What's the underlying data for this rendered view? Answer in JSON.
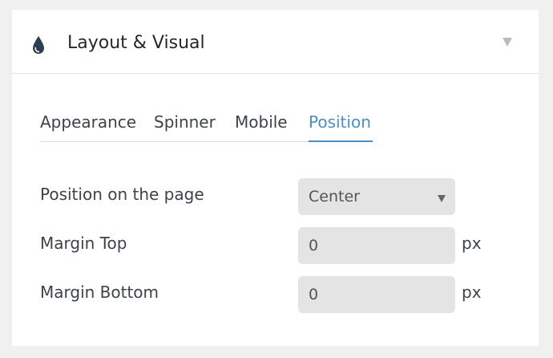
{
  "panel": {
    "title": "Layout & Visual",
    "icon": "drop-icon",
    "collapse_icon": "triangle-down-icon"
  },
  "tabs": [
    {
      "label": "Appearance",
      "active": false
    },
    {
      "label": "Spinner",
      "active": false
    },
    {
      "label": "Mobile",
      "active": false
    },
    {
      "label": "Position",
      "active": true
    }
  ],
  "fields": {
    "position": {
      "label": "Position on the page",
      "value": "Center",
      "options": [
        "Center"
      ]
    },
    "margin_top": {
      "label": "Margin Top",
      "value": "0",
      "unit": "px"
    },
    "margin_bottom": {
      "label": "Margin Bottom",
      "value": "0",
      "unit": "px"
    }
  },
  "colors": {
    "accent": "#4a90c8",
    "icon": "#2c3e50",
    "text": "#3c434a",
    "field_bg": "#e4e4e4"
  }
}
